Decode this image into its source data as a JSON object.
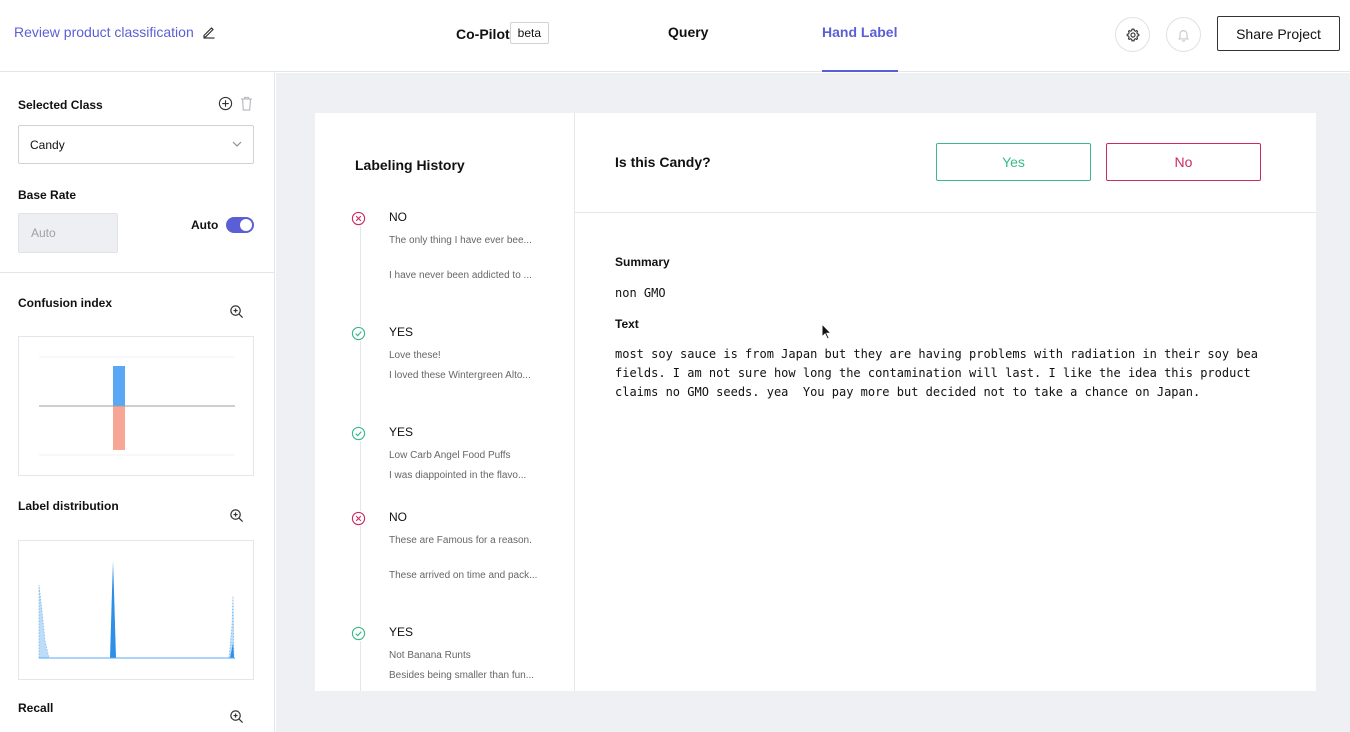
{
  "header": {
    "project_title": "Review product classification",
    "tabs": [
      {
        "label": "Co-Pilot",
        "badge": "beta"
      },
      {
        "label": "Query"
      },
      {
        "label": "Hand Label",
        "active": true
      }
    ],
    "share_label": "Share Project",
    "accent_color": "#5b5fd6"
  },
  "sidebar": {
    "selected_class_label": "Selected Class",
    "selected_class_value": "Candy",
    "base_rate_label": "Base Rate",
    "base_rate_placeholder": "Auto",
    "auto_label": "Auto",
    "auto_enabled": true,
    "confusion_label": "Confusion index",
    "label_distribution_label": "Label distribution",
    "recall_label": "Recall"
  },
  "history": {
    "title": "Labeling History",
    "items": [
      {
        "verdict": "NO",
        "summary": "The only thing I have ever bee...",
        "text": "I have never been addicted to ..."
      },
      {
        "verdict": "YES",
        "summary": "Love these!",
        "text": "I loved these Wintergreen Alto..."
      },
      {
        "verdict": "YES",
        "summary": "Low Carb Angel Food Puffs",
        "text": "I was diappointed in the flavo..."
      },
      {
        "verdict": "NO",
        "summary": "These are Famous for a reason.",
        "text": "These arrived on time and pack..."
      },
      {
        "verdict": "YES",
        "summary": "Not Banana Runts",
        "text": "Besides being smaller than fun..."
      }
    ]
  },
  "labeling": {
    "question": "Is this Candy?",
    "yes_label": "Yes",
    "no_label": "No",
    "summary_label": "Summary",
    "summary_value": "non GMO",
    "text_label": "Text",
    "text_lines": [
      "most soy sauce is from Japan but they are having problems with radiation in their soy bean",
      "fields. I am not sure how long the contamination will last. I like the idea this product",
      "claims no GMO seeds. yea  You pay more but decided not to take a chance on Japan."
    ]
  },
  "colors": {
    "yes": "#3bb98a",
    "no": "#cc2a62",
    "confusion_positive": "#5aa8f5",
    "confusion_negative": "#f7a594"
  }
}
